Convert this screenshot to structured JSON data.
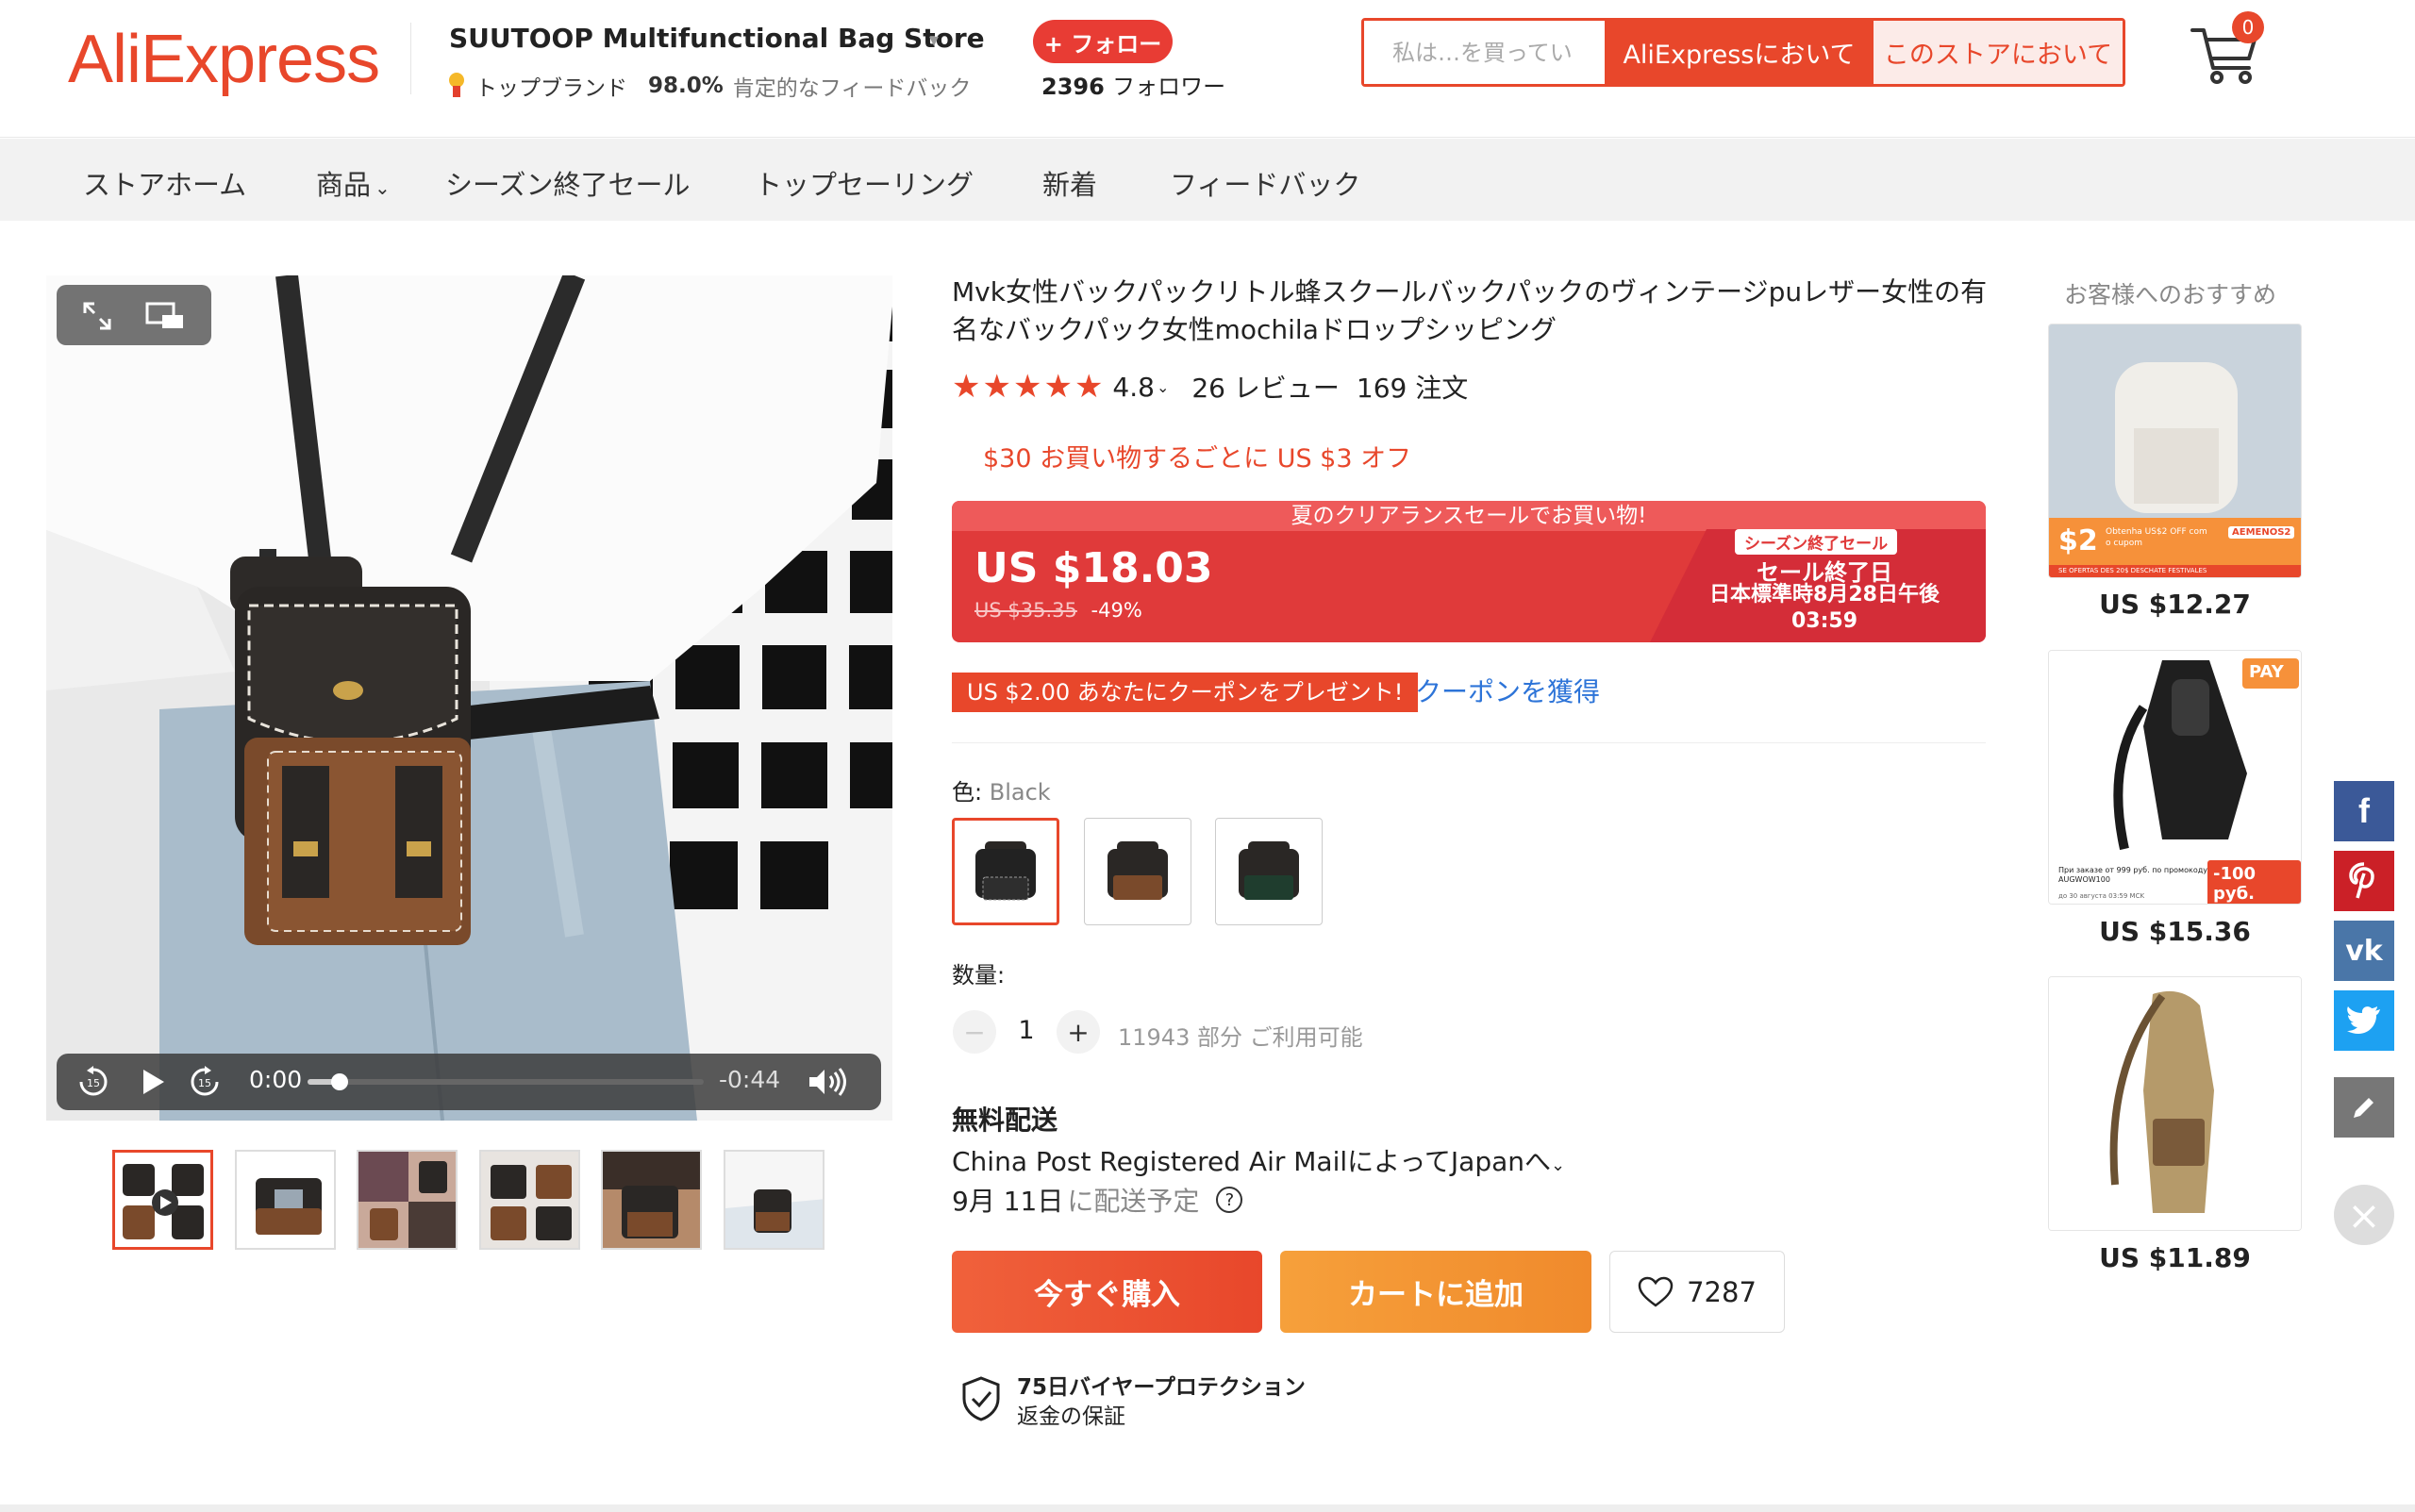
{
  "header": {
    "logo": "AliExpress",
    "store_name": "SUUTOOP Multifunctional Bag Store",
    "top_brand": "トップブランド",
    "feedback_percent": "98.0%",
    "feedback_label": "肯定的なフィードバック",
    "follow_label": "+ フォロー",
    "followers_count": "2396",
    "followers_label": "フォロワー",
    "search_placeholder": "私は…を買ってい",
    "search_ali_label": "AliExpressにおいて",
    "search_store_label": "このストアにおいて",
    "cart_count": "0"
  },
  "nav": {
    "items": [
      {
        "label": "ストアホーム"
      },
      {
        "label": "商品"
      },
      {
        "label": "シーズン終了セール"
      },
      {
        "label": "トップセーリング"
      },
      {
        "label": "新着"
      },
      {
        "label": "フィードバック"
      }
    ]
  },
  "media": {
    "time_current": "0:00",
    "time_remaining": "-0:44",
    "progress": 0.08,
    "skip_back": "15",
    "skip_forward": "15"
  },
  "product": {
    "title": "Mvk女性バックパックリトル蜂スクールバックパックのヴィンテージpuレザー女性の有名なバックパック女性mochilaドロップシッピング",
    "rating": "4.8",
    "reviews": "26 レビュー",
    "orders": "169 注文",
    "promo": "$30 お買い物するごとに US $3 オフ",
    "banner_headline": "夏のクリアランスセールでお買い物!",
    "price": "US $18.03",
    "price_original": "US $35.35",
    "discount": "-49%",
    "sale_tag": "シーズン終了セール",
    "sale_end_title": "セール終了日",
    "sale_end_date": "日本標準時8月28日午後",
    "sale_end_time": "03:59",
    "coupon_text": "US $2.00 あなたにクーポンをプレゼント!",
    "coupon_link": "クーポンを獲得",
    "color_label": "色:",
    "color_value": "Black",
    "quantity_label": "数量:",
    "quantity": "1",
    "available": "11943 部分 ご利用可能",
    "shipping_title": "無料配送",
    "shipping_method": "China Post Registered Air MailによってJapanへ",
    "delivery_date": "9月 11日",
    "delivery_suffix": "に配送予定",
    "buy_now": "今すぐ購入",
    "add_to_cart": "カートに追加",
    "wishlist_count": "7287",
    "protection_title": "75日バイヤープロテクション",
    "protection_sub": "返金の保証"
  },
  "recommendations": {
    "title": "お客様へのおすすめ",
    "items": [
      {
        "price": "US $12.27",
        "badge_left": "$2",
        "badge_right": "AEMENOS2",
        "caption": "Obtenha US$2 OFF com o cupom",
        "footer": "SE OFERTAS DES 20$ DESCHATE FESTIVALES"
      },
      {
        "price": "US $15.36",
        "badge_left": "При заказе от 999 руб. по промокоду AUGWOW100",
        "badge_right": "-100 руб.",
        "caption": "",
        "footer": "до 30 августа 03:59 MCK",
        "corner": "PAY"
      },
      {
        "price": "US $11.89",
        "badge_left": "",
        "badge_right": "",
        "caption": "",
        "footer": ""
      }
    ]
  },
  "social": [
    "facebook",
    "pinterest",
    "vk",
    "twitter",
    "edit"
  ],
  "colors": {
    "accent": "#e8472b",
    "banner": "#e03a3a",
    "link": "#2d74d8",
    "orange": "#f08a2c"
  }
}
